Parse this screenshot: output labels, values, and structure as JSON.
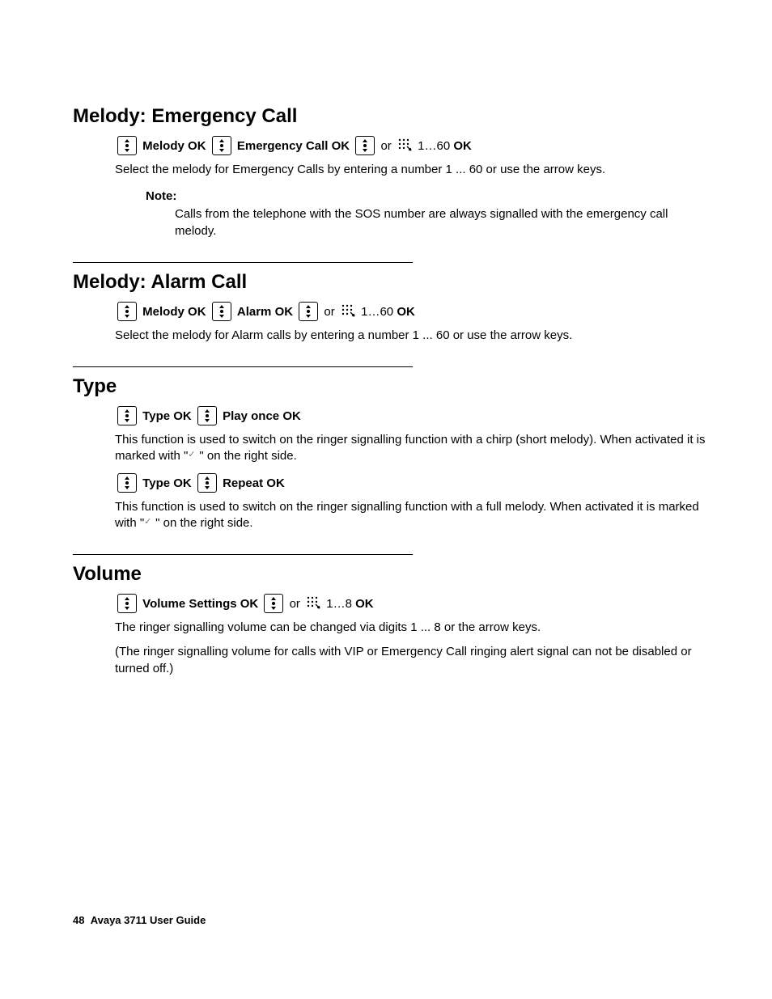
{
  "sections": {
    "emergency": {
      "heading": "Melody: Emergency Call",
      "nav": {
        "step1": "Melody",
        "ok1": "OK",
        "step2": "Emergency Call",
        "ok2": "OK",
        "or": "or",
        "range": "1…60",
        "ok3": "OK"
      },
      "body": "Select the melody for Emergency Calls by entering a number 1 ... 60 or use the arrow keys.",
      "note_label": "Note:",
      "note_text": "Calls from the telephone with the SOS number are always signalled with the emergency call melody."
    },
    "alarm": {
      "heading": "Melody: Alarm Call",
      "nav": {
        "step1": "Melody",
        "ok1": "OK",
        "step2": "Alarm",
        "ok2": "OK",
        "or": "or",
        "range": "1…60",
        "ok3": "OK"
      },
      "body": "Select the melody for Alarm calls by entering a number 1 ... 60 or use the arrow keys."
    },
    "type": {
      "heading": "Type",
      "nav1": {
        "step1": "Type",
        "ok1": "OK",
        "step2": "Play once",
        "ok2": "OK"
      },
      "body1a": "This function is used to switch on the ringer signalling function with a chirp (short melody). When activated it is marked with \"",
      "body1b": "\" on the right side.",
      "nav2": {
        "step1": "Type",
        "ok1": "OK",
        "step2": "Repeat",
        "ok2": "OK"
      },
      "body2a": "This function is used to switch on the ringer signalling function with a full melody. When activated it is marked with \"",
      "body2b": "\" on the right side."
    },
    "volume": {
      "heading": "Volume",
      "nav": {
        "step1": "Volume Settings",
        "ok1": "OK",
        "or": "or",
        "range": "1…8",
        "ok3": "OK"
      },
      "body1": "The ringer signalling volume can be changed via digits 1 ... 8 or the arrow keys.",
      "body2": "(The ringer signalling volume for calls with VIP or Emergency Call ringing alert signal can not be disabled or turned off.)"
    }
  },
  "footer": {
    "page_number": "48",
    "doc_title": "Avaya 3711 User Guide"
  }
}
